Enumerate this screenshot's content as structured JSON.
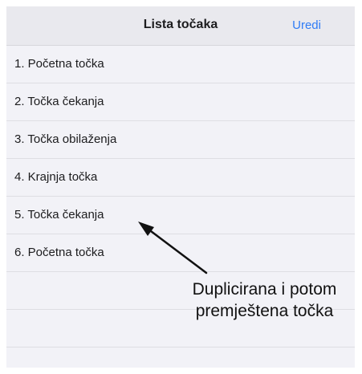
{
  "navbar": {
    "title": "Lista točaka",
    "edit_label": "Uredi"
  },
  "list": {
    "items": [
      {
        "label": "1. Početna točka"
      },
      {
        "label": "2. Točka čekanja"
      },
      {
        "label": "3. Točka obilaženja"
      },
      {
        "label": "4. Krajnja točka"
      },
      {
        "label": "5. Točka čekanja"
      },
      {
        "label": "6. Početna točka"
      }
    ],
    "empty_rows": 2
  },
  "annotation": {
    "line1": "Duplicirana i potom",
    "line2": "premještena točka"
  },
  "colors": {
    "accent": "#2f7cf6",
    "navbar_bg": "#e9e9ee",
    "list_bg": "#f2f2f7"
  }
}
